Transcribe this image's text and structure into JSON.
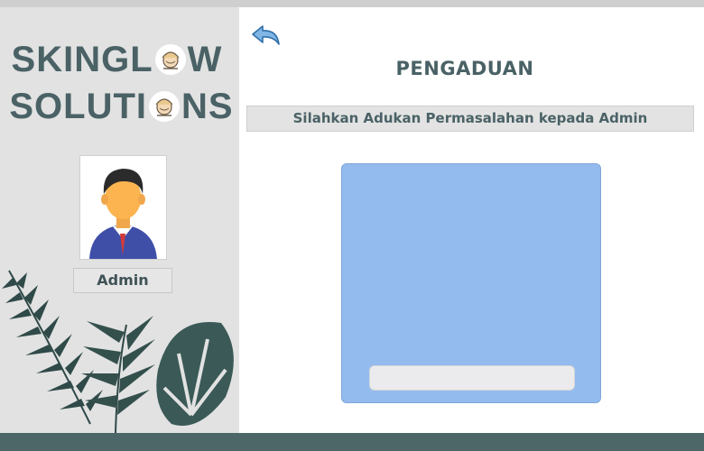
{
  "brand": {
    "line1_pre": "SKINGL",
    "line1_post": "W",
    "line2_pre": "SOLUTI",
    "line2_post": "NS",
    "logo_icon": "skincare-face-icon"
  },
  "sidebar": {
    "avatar_icon": "user-avatar-icon",
    "user_label": "Admin"
  },
  "main": {
    "back_icon": "back-arrow-icon",
    "title": "PENGADUAN",
    "subtitle": "Silahkan Adukan Permasalahan kepada Admin",
    "complaint_input": {
      "value": "",
      "placeholder": ""
    }
  },
  "colors": {
    "accent": "#4a6266",
    "complaint_box": "#93bbee",
    "footer": "#4d6769",
    "background": "#e2e2e2"
  }
}
